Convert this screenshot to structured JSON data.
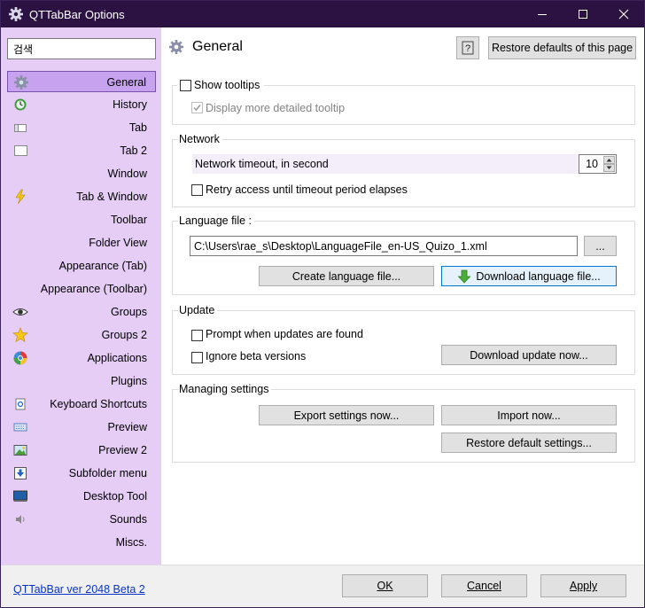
{
  "window": {
    "title": "QTTabBar Options"
  },
  "sidebar": {
    "search_value": "검색",
    "items": [
      {
        "label": "General",
        "icon": "gear-icon",
        "selected": true
      },
      {
        "label": "History",
        "icon": "history-icon"
      },
      {
        "label": "Tab",
        "icon": "tab-icon"
      },
      {
        "label": "Tab 2",
        "icon": "tab2-icon"
      },
      {
        "label": "Window",
        "icon": ""
      },
      {
        "label": "Tab & Window",
        "icon": "lightning-icon"
      },
      {
        "label": "Toolbar",
        "icon": ""
      },
      {
        "label": "Folder View",
        "icon": ""
      },
      {
        "label": "Appearance (Tab)",
        "icon": ""
      },
      {
        "label": "Appearance (Toolbar)",
        "icon": ""
      },
      {
        "label": "Groups",
        "icon": "eye-icon"
      },
      {
        "label": "Groups 2",
        "icon": "star-icon"
      },
      {
        "label": "Applications",
        "icon": "applications-icon"
      },
      {
        "label": "Plugins",
        "icon": ""
      },
      {
        "label": "Keyboard Shortcuts",
        "icon": "keyboard-shortcut-icon"
      },
      {
        "label": "Preview",
        "icon": "preview-icon"
      },
      {
        "label": "Preview 2",
        "icon": "preview2-icon"
      },
      {
        "label": "Subfolder menu",
        "icon": "subfolder-icon"
      },
      {
        "label": "Desktop Tool",
        "icon": "desktop-icon"
      },
      {
        "label": "Sounds",
        "icon": "speaker-icon"
      },
      {
        "label": "Miscs.",
        "icon": ""
      }
    ]
  },
  "main": {
    "page_title": "General",
    "help_label": "?",
    "restore_page_label": "Restore defaults of this page",
    "tooltips": {
      "show_tooltips": "Show tooltips",
      "show_tooltips_checked": false,
      "detailed_tooltip": "Display more detailed tooltip",
      "detailed_tooltip_checked": true
    },
    "network": {
      "title": "Network",
      "timeout_label": "Network timeout, in second",
      "timeout_value": "10",
      "retry_label": "Retry access until timeout period elapses",
      "retry_checked": false
    },
    "language": {
      "title": "Language file :",
      "path": "C:\\Users\\rae_s\\Desktop\\LanguageFile_en-US_Quizo_1.xml",
      "browse_label": "...",
      "create_label": "Create language file...",
      "download_label": "Download language file..."
    },
    "update": {
      "title": "Update",
      "prompt_label": "Prompt when updates are found",
      "ignore_beta_label": "Ignore beta versions",
      "download_update_label": "Download update now..."
    },
    "managing": {
      "title": "Managing settings",
      "export_label": "Export settings now...",
      "import_label": "Import now...",
      "restore_default_label": "Restore default settings..."
    }
  },
  "footer": {
    "version": "QTTabBar ver 2048 Beta 2",
    "ok": "OK",
    "cancel": "Cancel",
    "apply": "Apply"
  },
  "colors": {
    "titlebar": "#2b1242",
    "sidebar": "#e6cdf6",
    "selected_item": "#c7a3ef",
    "link": "#0a33c9"
  }
}
